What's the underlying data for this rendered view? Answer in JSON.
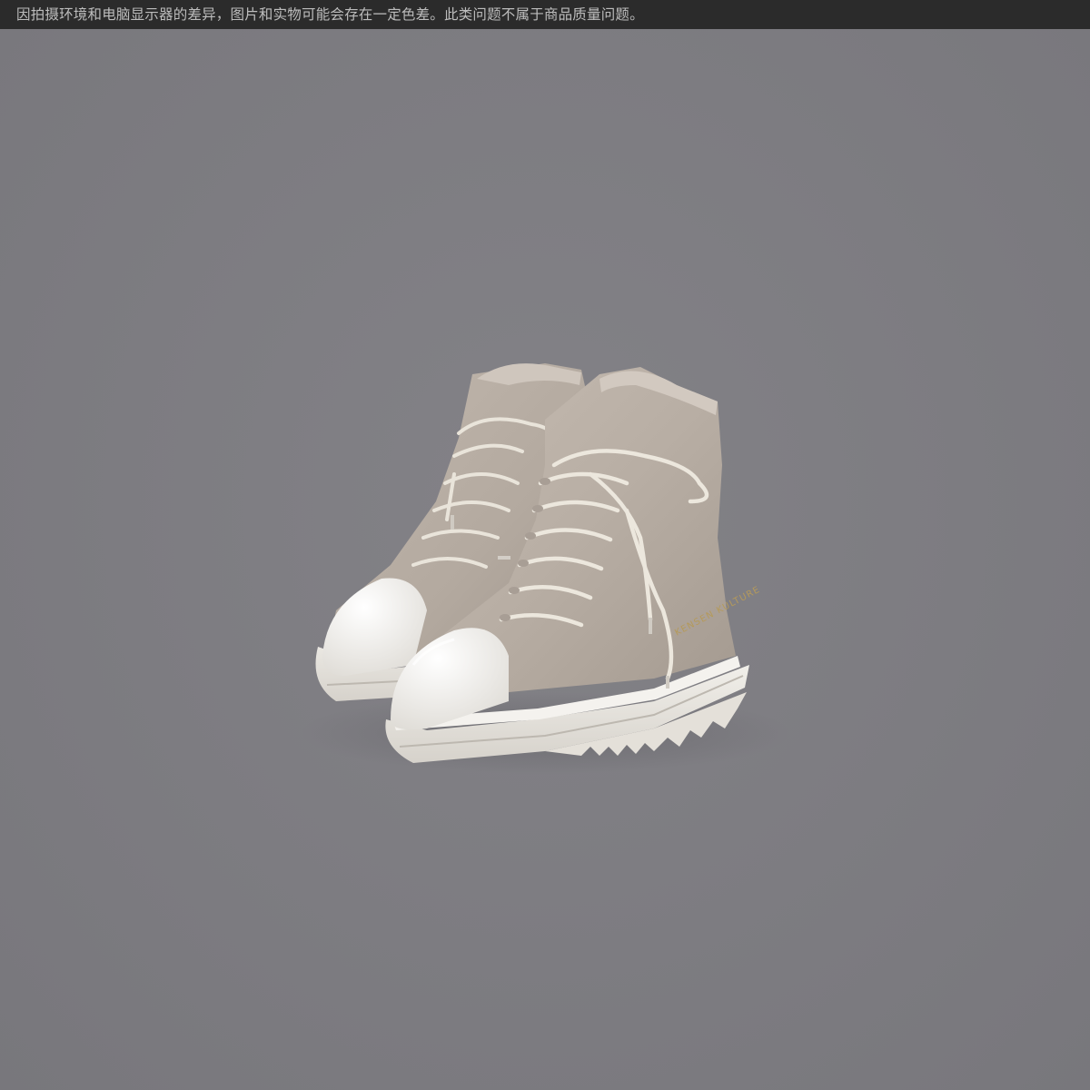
{
  "disclaimer": {
    "text": "因拍摄环境和电脑显示器的差异，图片和实物可能会存在一定色差。此类问题不属于商品质量问题。"
  },
  "product": {
    "brand_text": "KENSEN KULTURE"
  },
  "colors": {
    "background": "#7d7c81",
    "top_bar": "#2b2b2b",
    "suede": "#b7ada4",
    "sole": "#e8e5df",
    "laces": "#e9e4da",
    "brand_print": "#b59a5a"
  }
}
